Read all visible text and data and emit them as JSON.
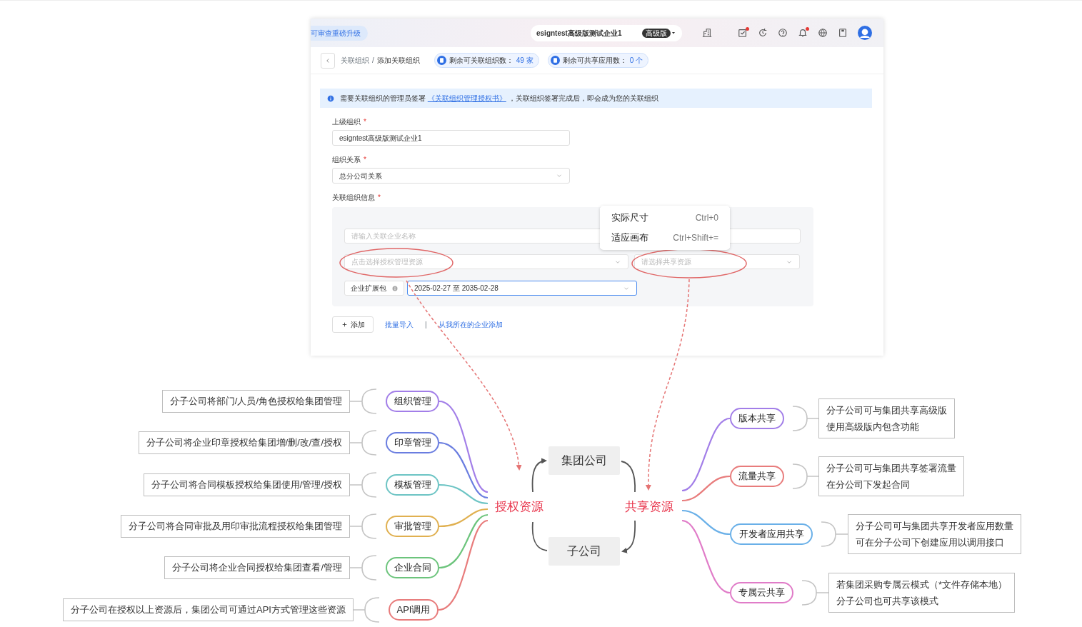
{
  "app": {
    "banner": "可审查重磅升级",
    "org_name": "esigntest高级版测试企业1",
    "plan_badge": "高级版",
    "toolbar_icons": [
      {
        "kind": "building",
        "dot": false
      },
      {
        "kind": "task",
        "dot": true
      },
      {
        "kind": "history",
        "dot": false
      },
      {
        "kind": "help",
        "dot": false
      },
      {
        "kind": "bell",
        "dot": true
      },
      {
        "kind": "globe",
        "dot": false
      },
      {
        "kind": "save",
        "dot": false
      },
      {
        "kind": "avatar",
        "dot": false
      }
    ],
    "breadcrumb": [
      "关联组织",
      "添加关联组织"
    ],
    "breadcrumb_separator": "/",
    "quotas": [
      {
        "label": "剩余可关联组织数：",
        "value": "49 家"
      },
      {
        "label": "剩余可共享应用数：",
        "value": "0 个"
      }
    ],
    "notice": {
      "before": "需要关联组织的管理员签署",
      "link": "《关联组织管理授权书》",
      "after": "，关联组织签署完成后，即会成为您的关联组织"
    },
    "fields": [
      {
        "label": "上级组织",
        "required_mark": "*",
        "kind": "input",
        "value": "esigntest高级版测试企业1"
      },
      {
        "label": "组织关系",
        "required_mark": "*",
        "kind": "select",
        "value": "总分公司关系"
      }
    ],
    "section": {
      "label": "关联组织信息",
      "required_mark": "*",
      "name_placeholder": "请输入关联企业名称",
      "auth_placeholder": "点击选择授权管理资源",
      "share_placeholder": "请选择共享资源",
      "package_label": "企业扩展包",
      "package_value": "2025-02-27 至 2035-02-28"
    },
    "actions": {
      "add": "添加",
      "import": "批量导入",
      "divider": "|",
      "from_mine": "从我所在的企业添加"
    }
  },
  "context_menu": [
    {
      "label": "实际尺寸",
      "shortcut": "Ctrl+0"
    },
    {
      "label": "适应画布",
      "shortcut": "Ctrl+Shift+="
    }
  ],
  "mindmap": {
    "top": "集团公司",
    "bottom": "子公司",
    "left_center": "授权资源",
    "right_center": "共享资源",
    "left_branches": [
      {
        "label": "组织管理",
        "color": "#a27ee8",
        "note": "分子公司将部门/人员/角色授权给集团管理"
      },
      {
        "label": "印章管理",
        "color": "#6a7de0",
        "note": "分子公司将企业印章授权给集团增/删/改/查/授权"
      },
      {
        "label": "模板管理",
        "color": "#6cc4c4",
        "note": "分子公司将合同模板授权给集团使用/管理/授权"
      },
      {
        "label": "审批管理",
        "color": "#e0b050",
        "note": "分子公司将合同审批及用印审批流程授权给集团管理"
      },
      {
        "label": "企业合同",
        "color": "#6cc47c",
        "note": "分子公司将企业合同授权给集团查看/管理"
      },
      {
        "label": "API调用",
        "color": "#e87c7c",
        "note": "分子公司在授权以上资源后，集团公司可通过API方式管理这些资源"
      }
    ],
    "right_branches": [
      {
        "label": "版本共享",
        "color": "#a27ee8",
        "note_lines": [
          "分子公司可与集团共享高级版",
          "使用高级版内包含功能"
        ]
      },
      {
        "label": "流量共享",
        "color": "#e87c7c",
        "note_lines": [
          "分子公司可与集团共享签署流量",
          "在分公司下发起合同"
        ]
      },
      {
        "label": "开发者应用共享",
        "color": "#6ab0e8",
        "note_lines": [
          "分子公司可与集团共享开发者应用数量",
          "可在分子公司下创建应用以调用接口"
        ]
      },
      {
        "label": "专属云共享",
        "color": "#e07cc8",
        "note_lines": [
          "若集团采购专属云模式（*文件存储本地）",
          "分子公司也可共享该模式"
        ]
      }
    ]
  }
}
